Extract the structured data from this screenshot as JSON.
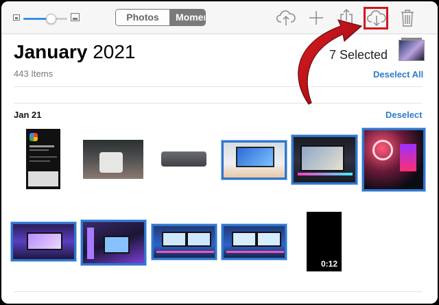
{
  "toolbar": {
    "zoom_slider": {
      "value": 0.62
    },
    "segments": [
      {
        "label": "Photos",
        "active": false
      },
      {
        "label": "Moments",
        "active": true
      }
    ],
    "actions": [
      {
        "name": "upload-icon",
        "highlighted": false
      },
      {
        "name": "add-icon",
        "highlighted": false
      },
      {
        "name": "share-icon",
        "highlighted": false
      },
      {
        "name": "download-icon",
        "highlighted": true
      },
      {
        "name": "trash-icon",
        "highlighted": false
      }
    ]
  },
  "header": {
    "month": "January",
    "year": "2021",
    "item_count": "443 Items",
    "selected_text": "7 Selected",
    "deselect_all_label": "Deselect All"
  },
  "section": {
    "date_label": "Jan 21",
    "deselect_label": "Deselect"
  },
  "photos": [
    {
      "name": "google-photos-screenshot",
      "selected": false
    },
    {
      "name": "mac-mini-on-desk",
      "selected": false
    },
    {
      "name": "mac-mini-gray",
      "selected": false
    },
    {
      "name": "desk-setup-monitor",
      "selected": true
    },
    {
      "name": "gaming-setup-curved-monitor",
      "selected": true
    },
    {
      "name": "rgb-pc-case",
      "selected": true
    },
    {
      "name": "purple-desk-setup",
      "selected": true
    },
    {
      "name": "neon-gaming-room",
      "selected": true
    },
    {
      "name": "dual-monitor-desk-1",
      "selected": true
    },
    {
      "name": "dual-monitor-desk-2",
      "selected": true
    },
    {
      "name": "video-clip",
      "selected": false,
      "duration": "0:12"
    }
  ],
  "colors": {
    "accent_blue": "#2f7bc8",
    "selection_border": "#2f76cc",
    "annotation_red": "#d4141a"
  }
}
